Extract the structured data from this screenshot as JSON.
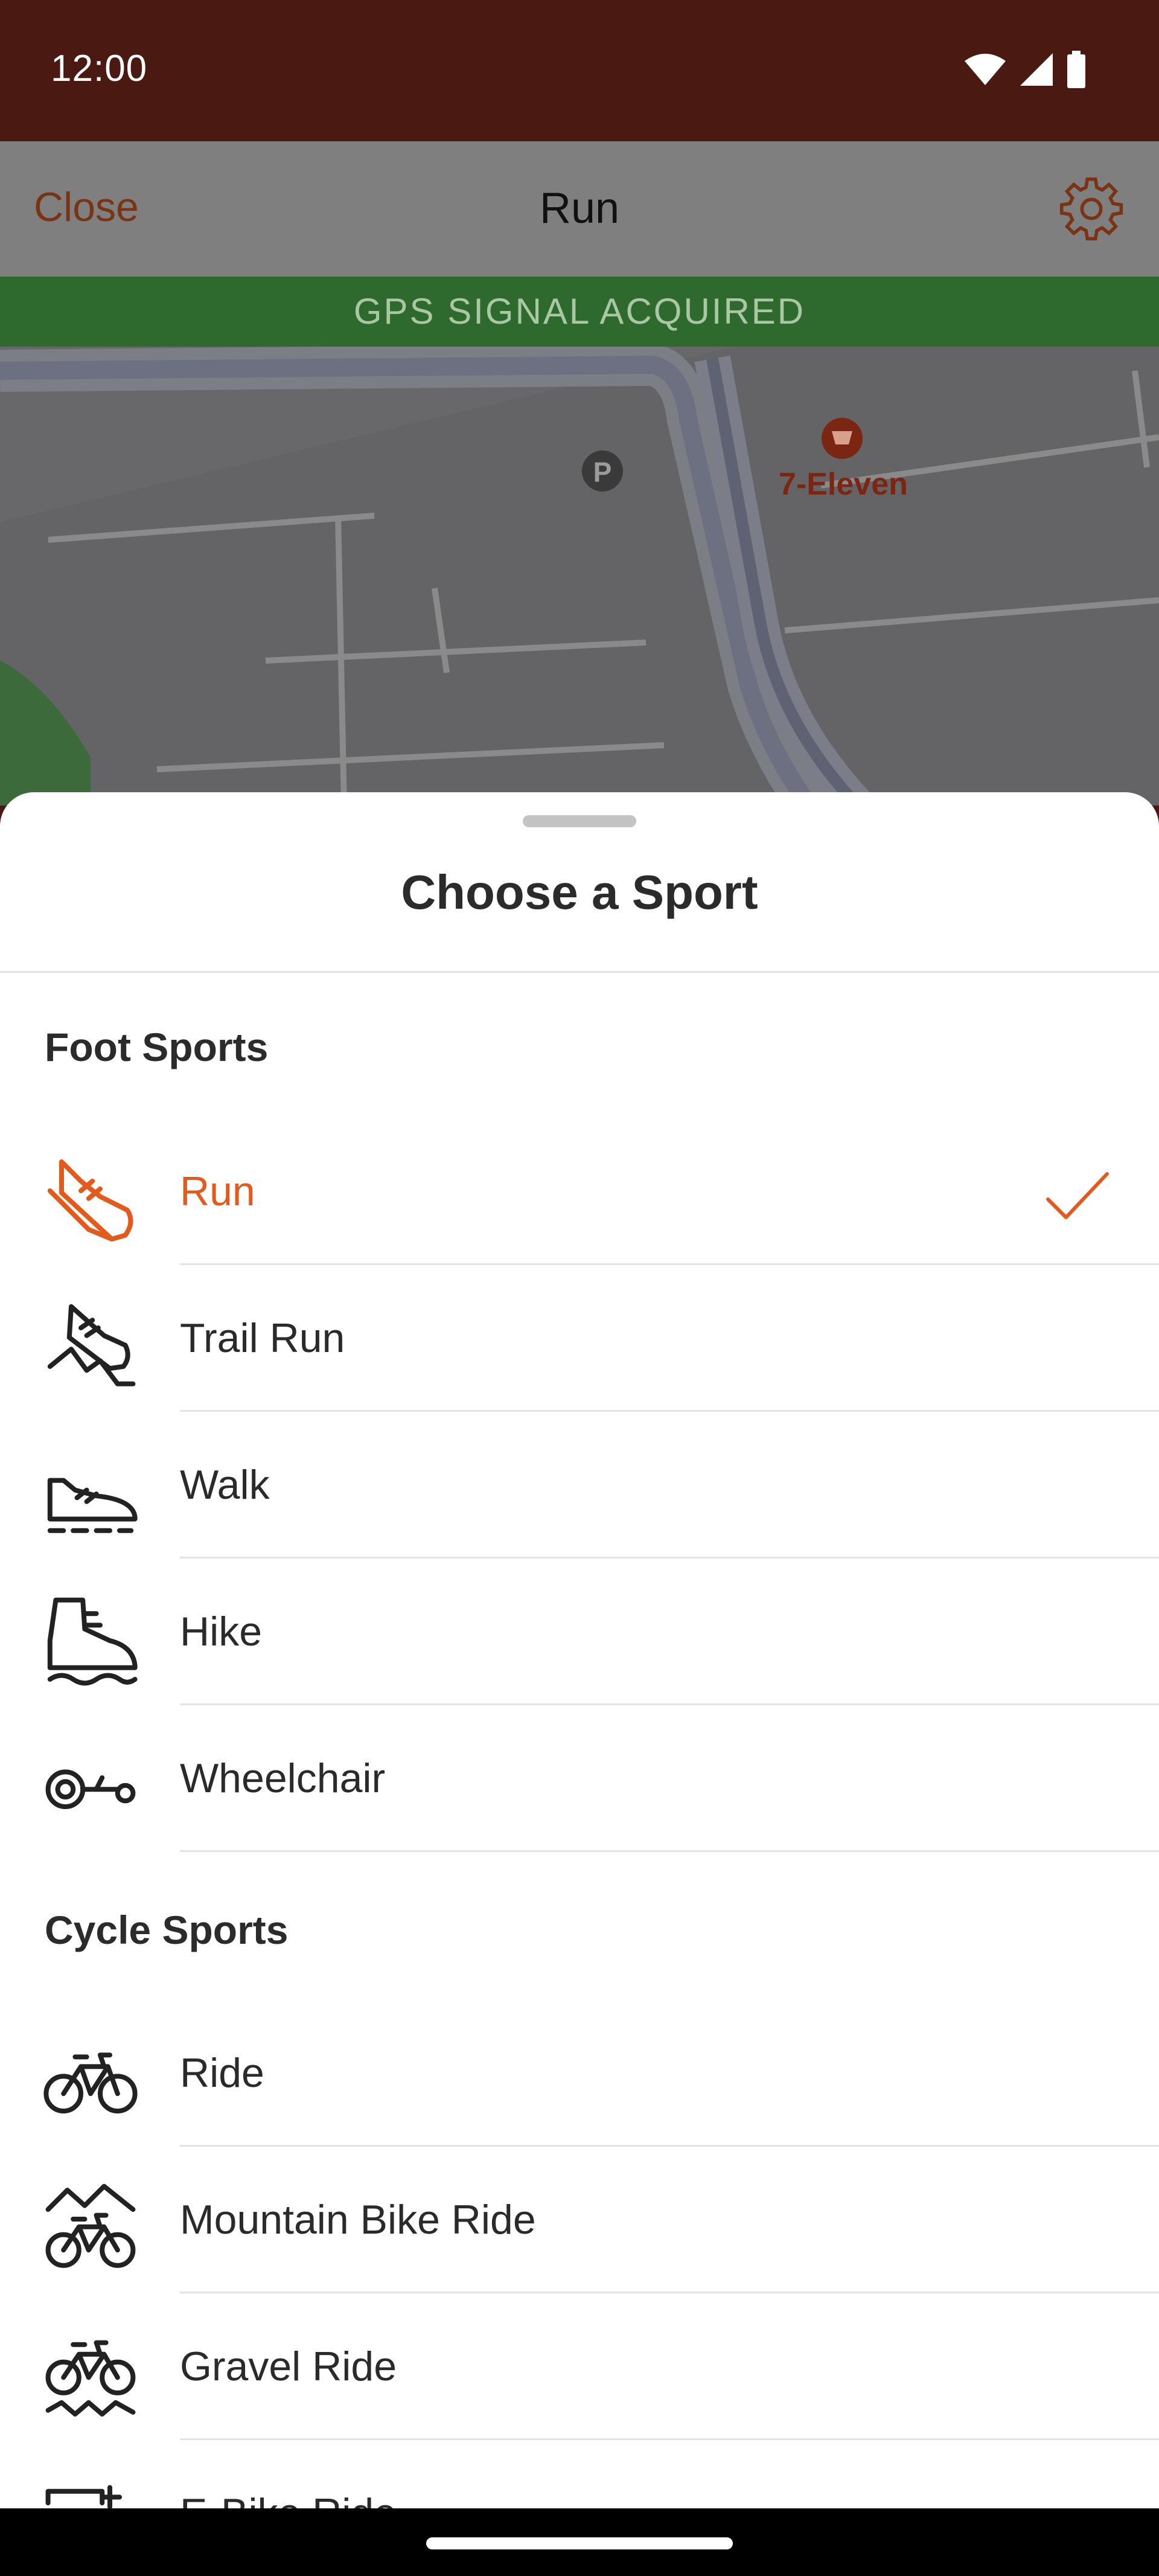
{
  "status_bar": {
    "time": "12:00"
  },
  "app_bar": {
    "close_label": "Close",
    "title": "Run"
  },
  "gps_banner": "GPS SIGNAL ACQUIRED",
  "map": {
    "poi_store": "7-Eleven",
    "poi_parking": "P"
  },
  "sheet": {
    "title": "Choose a Sport",
    "sections": [
      {
        "header": "Foot Sports",
        "items": [
          {
            "label": "Run",
            "icon": "run-shoe-icon",
            "selected": true
          },
          {
            "label": "Trail Run",
            "icon": "trail-run-icon"
          },
          {
            "label": "Walk",
            "icon": "walk-shoe-icon"
          },
          {
            "label": "Hike",
            "icon": "hike-boot-icon"
          },
          {
            "label": "Wheelchair",
            "icon": "wheelchair-icon"
          }
        ]
      },
      {
        "header": "Cycle Sports",
        "items": [
          {
            "label": "Ride",
            "icon": "bike-icon"
          },
          {
            "label": "Mountain Bike Ride",
            "icon": "mountain-bike-icon"
          },
          {
            "label": "Gravel Ride",
            "icon": "gravel-bike-icon"
          },
          {
            "label": "E-Bike Ride",
            "icon": "ebike-icon"
          }
        ]
      }
    ]
  },
  "colors": {
    "accent": "#e35a1c",
    "status_bar": "#4a1a12",
    "gps_green": "#2e6a2e"
  }
}
